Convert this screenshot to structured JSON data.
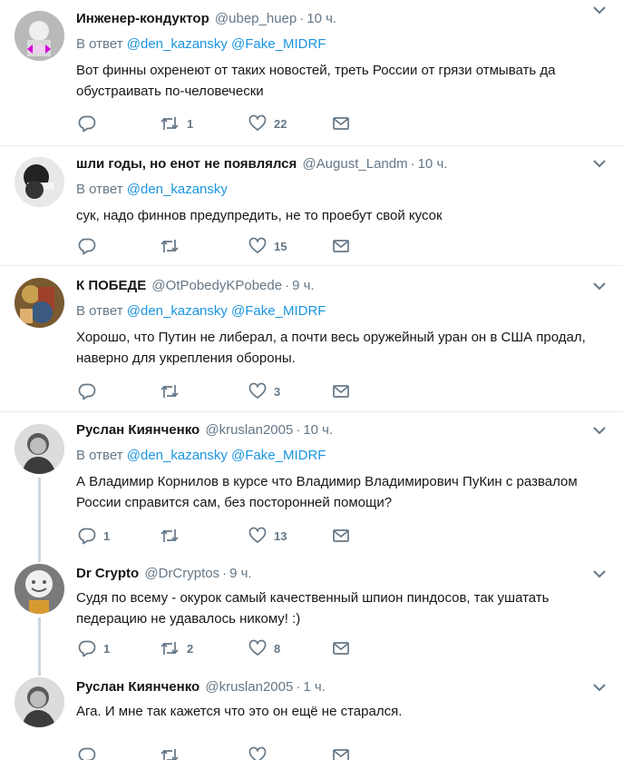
{
  "reply_prefix": "В ответ",
  "tweets": [
    {
      "name": "Инженер-кондуктор",
      "handle": "@ubep_huep",
      "time": "10 ч.",
      "mentions": [
        "@den_kazansky",
        "@Fake_MIDRF"
      ],
      "text": "Вот финны охренеют от таких новостей, треть России от грязи отмывать да обустраивать по-человечески",
      "replies": "",
      "retweets": "1",
      "likes": "22"
    },
    {
      "name": "шли годы, но енот не появлялся",
      "handle": "@August_Landm",
      "time": "10 ч.",
      "mentions": [
        "@den_kazansky"
      ],
      "text": "сук, надо финнов предупредить, не то проебут свой кусок",
      "replies": "",
      "retweets": "",
      "likes": "15"
    },
    {
      "name": "К ПОБЕДЕ",
      "handle": "@OtPobedyKPobede",
      "time": "9 ч.",
      "mentions": [
        "@den_kazansky",
        "@Fake_MIDRF"
      ],
      "text": "Хорошо, что Путин не либерал, а почти весь оружейный уран он в США продал, наверно для укрепления обороны.",
      "replies": "",
      "retweets": "",
      "likes": "3"
    },
    {
      "name": "Руслан Киянченко",
      "handle": "@kruslan2005",
      "time": "10 ч.",
      "mentions": [
        "@den_kazansky",
        "@Fake_MIDRF"
      ],
      "text": "А Владимир Корнилов в курсе что Владимир Владимирович ПуКин с развалом России справится сам, без посторонней помощи?",
      "replies": "1",
      "retweets": "",
      "likes": "13"
    },
    {
      "name": "Dr Crypto",
      "handle": "@DrCryptos",
      "time": "9 ч.",
      "mentions": [],
      "text": "Судя по всему - окурок самый качественный шпион пиндосов, так ушатать педерацию не удавалось никому! :)",
      "replies": "1",
      "retweets": "2",
      "likes": "8"
    },
    {
      "name": "Руслан Киянченко",
      "handle": "@kruslan2005",
      "time": "1 ч.",
      "mentions": [],
      "text": "Ага. И мне так кажется что это он ещё не старался.",
      "replies": "",
      "retweets": "",
      "likes": ""
    }
  ]
}
